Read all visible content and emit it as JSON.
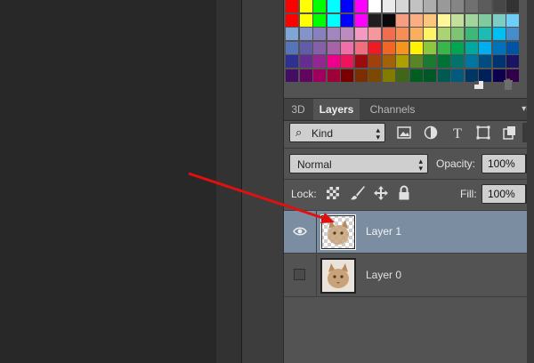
{
  "colors": {
    "swatches": [
      "#ff0000",
      "#ffff00",
      "#00ff00",
      "#00ffff",
      "#0000ff",
      "#ff00ff",
      "#ffffff",
      "#ebebeb",
      "#d6d6d6",
      "#c2c2c2",
      "#adadad",
      "#999999",
      "#858585",
      "#707070",
      "#5c5c5c",
      "#474747",
      "#333333",
      "#ff0000",
      "#ffff00",
      "#00ff00",
      "#00ffff",
      "#0000ff",
      "#ff00ff",
      "#1f1f1f",
      "#0a0a0a",
      "#f79d82",
      "#fbad83",
      "#fdc67f",
      "#fff799",
      "#c3df9b",
      "#a4d49d",
      "#81ca9d",
      "#7ecdc4",
      "#6dcff6",
      "#7ea7d8",
      "#8493ca",
      "#8881be",
      "#a187be",
      "#bc8cbf",
      "#f49ac2",
      "#f5989d",
      "#f26c4f",
      "#f68e55",
      "#fbaf5c",
      "#fff467",
      "#acd372",
      "#7dc473",
      "#3cb878",
      "#1cbbb4",
      "#00bff3",
      "#448ccb",
      "#5674b9",
      "#605ca8",
      "#8560a8",
      "#a763a8",
      "#f06eaa",
      "#f26d7d",
      "#ed1c24",
      "#f26522",
      "#f7941d",
      "#fff200",
      "#8dc63f",
      "#39b54a",
      "#00a651",
      "#00a99d",
      "#00aeef",
      "#0072bc",
      "#0054a6",
      "#2e3192",
      "#662d91",
      "#92278f",
      "#ec008c",
      "#ed145b",
      "#9e0b0f",
      "#a0410d",
      "#a3620a",
      "#aba000",
      "#598527",
      "#1a7b30",
      "#007236",
      "#00746b",
      "#0076a3",
      "#004b80",
      "#003471",
      "#1b1464",
      "#440e62",
      "#630460",
      "#9e005d",
      "#9e0039",
      "#790000",
      "#7b2e00",
      "#7d4900",
      "#827b00",
      "#406618",
      "#005e20",
      "#005826",
      "#005952",
      "#005b7f",
      "#003663",
      "#002157",
      "#0d004c",
      "#32004b"
    ],
    "accent_selected_row": "#7b8da0",
    "annotation_arrow": "#e01010"
  },
  "tabs": [
    {
      "label": "3D",
      "active": false
    },
    {
      "label": "Layers",
      "active": true
    },
    {
      "label": "Channels",
      "active": false
    }
  ],
  "filter": {
    "kind_label": "Kind",
    "icons": [
      "image-filter-icon",
      "adjustment-filter-icon",
      "type-filter-icon",
      "shape-filter-icon",
      "smart-object-filter-icon"
    ]
  },
  "blend": {
    "mode": "Normal",
    "opacity_label": "Opacity:",
    "opacity_value": "100%"
  },
  "lock": {
    "label": "Lock:",
    "fill_label": "Fill:",
    "fill_value": "100%"
  },
  "layers": [
    {
      "name": "Layer 1",
      "visible": true,
      "selected": true
    },
    {
      "name": "Layer 0",
      "visible": false,
      "selected": false
    }
  ]
}
